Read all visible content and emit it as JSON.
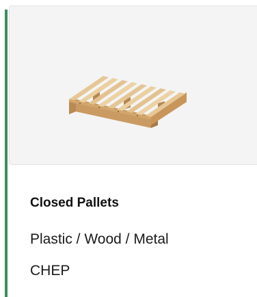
{
  "card": {
    "title": "Closed Pallets",
    "materials": "Plastic / Wood / Metal",
    "brand": "CHEP",
    "image_icon": "wooden-pallet-icon",
    "accent_color": "#3a8f5c"
  }
}
